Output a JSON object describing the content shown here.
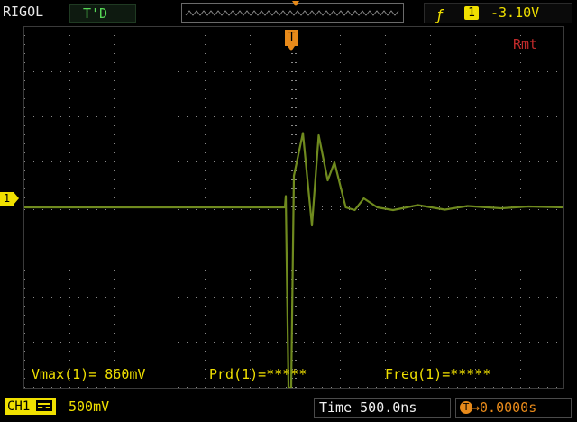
{
  "header": {
    "brand": "RIGOL",
    "trigger_status": "T'D",
    "trigger_edge_icon": "rising-edge-icon",
    "trigger_channel": "1",
    "trigger_level": "-3.10V"
  },
  "screen": {
    "trigger_position_marker": "T",
    "remote_indicator": "Rmt",
    "channel_ref_marker": "1",
    "colors": {
      "trace": "#6f8a1e",
      "grid": "#8a8a8a",
      "accent": "#f0e000",
      "trigger": "#e88a1a"
    }
  },
  "measurements": [
    {
      "text": "Vmax(1)= 860mV"
    },
    {
      "text": "Prd(1)=*****"
    },
    {
      "text": "Freq(1)=*****"
    }
  ],
  "footer": {
    "channel_label": "CH1",
    "channel_coupling_icon": "dc-coupling-icon",
    "channel_scale": "500mV",
    "time_base": "Time 500.0ns",
    "trigger_offset_icon": "trigger-offset-icon",
    "trigger_offset": "→0.0000s"
  },
  "chart_data": {
    "type": "line",
    "title": "",
    "xlabel": "",
    "ylabel": "",
    "x_unit": "div",
    "y_unit": "div",
    "xlim": [
      -6,
      6
    ],
    "ylim": [
      -4,
      4
    ],
    "grid": true,
    "series": [
      {
        "x": [
          -6,
          -0.2,
          -0.18,
          -0.12,
          -0.06,
          0.0,
          0.2,
          0.4,
          0.55,
          0.75,
          0.9,
          1.15,
          1.35,
          1.55,
          1.85,
          2.2,
          2.75,
          3.35,
          3.85,
          4.6,
          5.2,
          6.0
        ],
        "y": [
          0.0,
          0.0,
          0.25,
          -4.0,
          -4.0,
          0.7,
          1.65,
          -0.4,
          1.6,
          0.6,
          1.0,
          0.0,
          -0.06,
          0.2,
          0.0,
          -0.06,
          0.05,
          -0.05,
          0.03,
          -0.02,
          0.02,
          0.0
        ]
      }
    ]
  }
}
